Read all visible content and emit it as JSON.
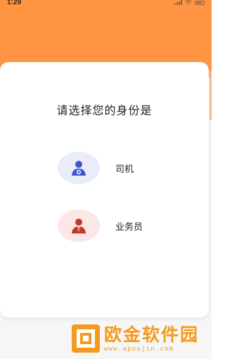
{
  "status_bar": {
    "time": "1:29"
  },
  "colors": {
    "header": "#ff9543",
    "driver_accent": "#3f55c9",
    "sales_accent": "#c0392b",
    "watermark": "#f59a1a"
  },
  "dialog": {
    "title": "请选择您的身份是",
    "roles": [
      {
        "label": "司机",
        "icon": "driver-avatar-icon"
      },
      {
        "label": "业务员",
        "icon": "salesperson-avatar-icon"
      }
    ]
  },
  "watermark": {
    "title": "欧金软件园",
    "url": "www.apoujin.com"
  }
}
